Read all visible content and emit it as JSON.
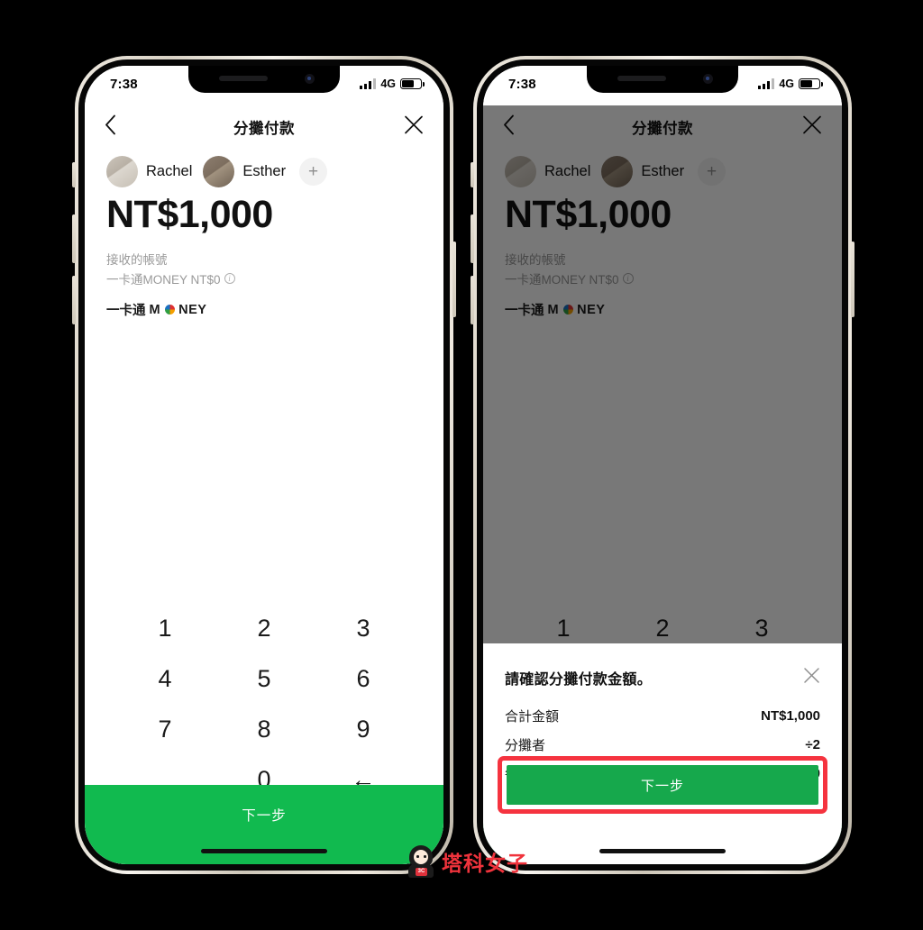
{
  "status_bar": {
    "time": "7:38",
    "network": "4G",
    "signal_icon": "signal-bars-icon",
    "battery_icon": "battery-icon"
  },
  "navbar": {
    "title": "分攤付款",
    "back_icon": "chevron-left-icon",
    "close_icon": "close-x-icon"
  },
  "people": {
    "members": [
      {
        "name": "Rachel",
        "avatar": "avatar-rachel"
      },
      {
        "name": "Esther",
        "avatar": "avatar-esther"
      }
    ],
    "add_label": "+"
  },
  "amount": {
    "value": "NT$1,000"
  },
  "account": {
    "label": "接收的帳號",
    "value": "一卡通MONEY NT$0",
    "info_icon": "info-circle-icon",
    "brand_prefix": "一卡通",
    "brand_m": "M",
    "brand_suffix": "NEY",
    "brand_logo_icon": "ipass-money-logo-icon"
  },
  "keypad": {
    "rows": [
      [
        "1",
        "2",
        "3"
      ],
      [
        "4",
        "5",
        "6"
      ],
      [
        "7",
        "8",
        "9"
      ],
      [
        "",
        "0",
        "←"
      ]
    ],
    "backspace_icon": "backspace-arrow-icon"
  },
  "cta": {
    "label": "下一步"
  },
  "sheet": {
    "title": "請確認分攤付款金額。",
    "close_icon": "close-x-icon",
    "rows": [
      {
        "label": "合計金額",
        "value": "NT$1,000"
      },
      {
        "label": "分攤者",
        "value": "÷2"
      },
      {
        "label": "每人分攤金額",
        "value": "NT$500"
      }
    ],
    "cta_label": "下一步",
    "highlight_color": "#f5333f"
  },
  "watermark": {
    "text": "塔科女子",
    "badge": "3C",
    "color": "#f0333c"
  },
  "colors": {
    "brand_green": "#11ba4f",
    "sheet_green": "#16a84c",
    "highlight_red": "#f5333f",
    "dim_overlay": "rgba(0,0,0,0.53)"
  }
}
